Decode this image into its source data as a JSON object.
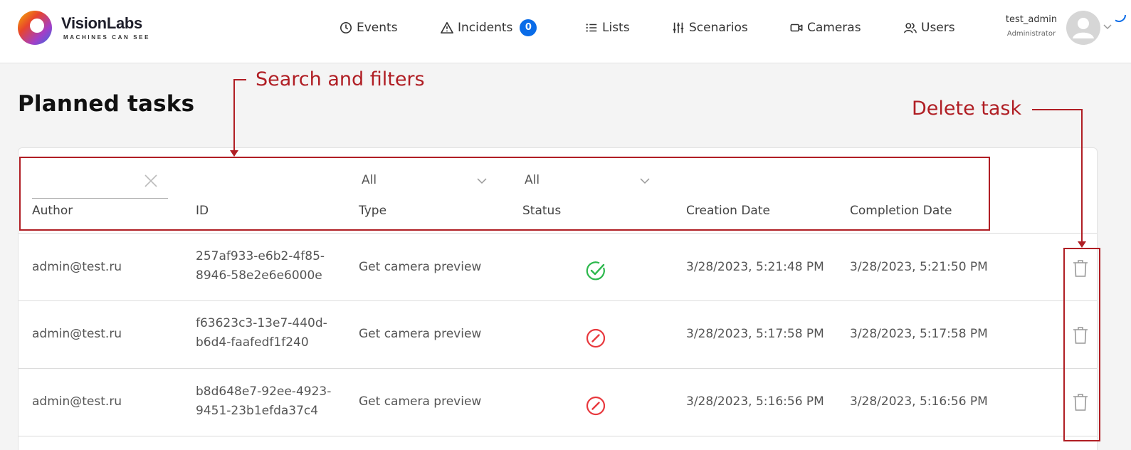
{
  "app": {
    "brand": "VisionLabs",
    "tagline": "MACHINES CAN SEE"
  },
  "nav": {
    "events": "Events",
    "incidents": "Incidents",
    "incidents_count": "0",
    "lists": "Lists",
    "scenarios": "Scenarios",
    "cameras": "Cameras",
    "users": "Users"
  },
  "user": {
    "name": "test_admin",
    "role": "Administrator"
  },
  "page": {
    "title": "Planned tasks"
  },
  "filters": {
    "author_value": "",
    "type_selected": "All",
    "status_selected": "All"
  },
  "columns": {
    "author": "Author",
    "id": "ID",
    "type": "Type",
    "status": "Status",
    "creation_date": "Creation Date",
    "completion_date": "Completion Date"
  },
  "rows": [
    {
      "author": "admin@test.ru",
      "id": "257af933-e6b2-4f85-8946-58e2e6e6000e",
      "type": "Get camera preview",
      "status": "done",
      "creation_date": "3/28/2023, 5:21:48 PM",
      "completion_date": "3/28/2023, 5:21:50 PM"
    },
    {
      "author": "admin@test.ru",
      "id": "f63623c3-13e7-440d-b6d4-faafedf1f240",
      "type": "Get camera preview",
      "status": "cancelled",
      "creation_date": "3/28/2023, 5:17:58 PM",
      "completion_date": "3/28/2023, 5:17:58 PM"
    },
    {
      "author": "admin@test.ru",
      "id": "b8d648e7-92ee-4923-9451-23b1efda37c4",
      "type": "Get camera preview",
      "status": "cancelled",
      "creation_date": "3/28/2023, 5:16:56 PM",
      "completion_date": "3/28/2023, 5:16:56 PM"
    }
  ],
  "annotations": {
    "search_filters": "Search and filters",
    "delete_task": "Delete task"
  },
  "colors": {
    "accent": "#0a6ce8",
    "annotation": "#b01e24",
    "status_done": "#2db84d",
    "status_cancelled": "#e8383d"
  }
}
